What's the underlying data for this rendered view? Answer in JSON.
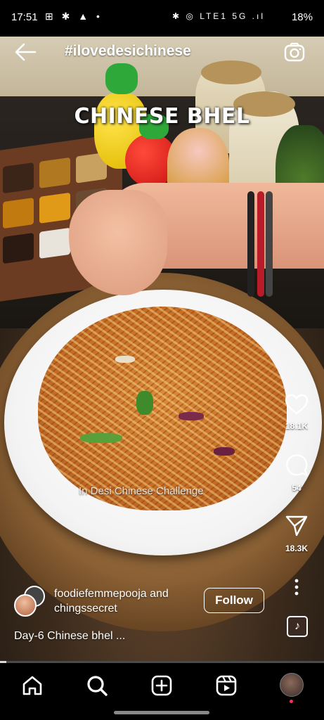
{
  "status_bar": {
    "time": "17:51",
    "left_icons": "⊞ ✱ ▲ •",
    "right_icons": "✱ ◎ LTE1 5G .ıl",
    "battery": "18%"
  },
  "header": {
    "hashtag": "#ilovedesichinese",
    "back_icon": "arrow-left-icon",
    "camera_icon": "camera-icon"
  },
  "video": {
    "overlay_title": "CHINESE BHEL",
    "effect_label": "In Desi Chinese Challenge"
  },
  "actions": {
    "likes": "18.1K",
    "comments": "54",
    "shares": "18.3K",
    "more_icon": "more-vertical-icon"
  },
  "author": {
    "line1": "foodiefemmepooja and",
    "line2": "chingssecret",
    "follow_label": "Follow"
  },
  "caption": "Day-6 Chinese bhel ...",
  "progress": {
    "fraction": 0.02
  },
  "bottom_nav": {
    "items": [
      "home-icon",
      "search-icon",
      "create-icon",
      "reels-icon",
      "profile-avatar"
    ]
  },
  "colors": {
    "background": "#000000",
    "text": "#ffffff",
    "notification_dot": "#ff2d55"
  }
}
